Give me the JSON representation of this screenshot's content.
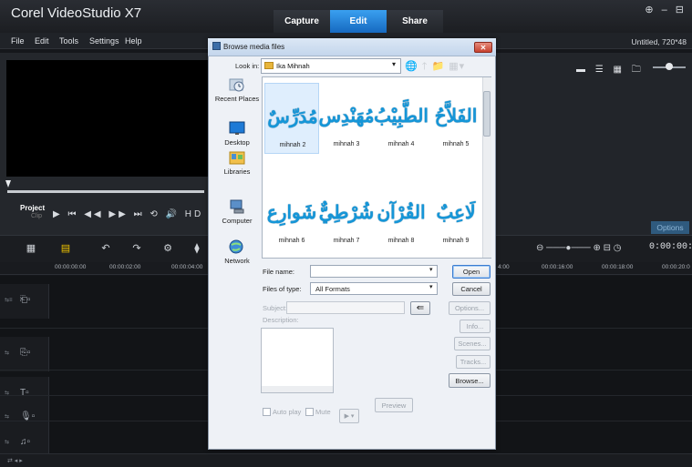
{
  "app": {
    "title": "Corel VideoStudio X7",
    "steps": [
      "Capture",
      "Edit",
      "Share"
    ],
    "window_controls": "⊕ ‒ ⊟",
    "project_info": "Untitled, 720*48"
  },
  "menu": [
    "File",
    "Edit",
    "Tools",
    "Settings",
    "Help"
  ],
  "player": {
    "project_label": "Project",
    "clip_label": "Clip",
    "controls": "▶ ⏮ ◀◀ ▶▶ ⏭ ⟲ 🔊 HD"
  },
  "right_panel": {
    "options_label": "Options",
    "view_icons": "▬ ☰ ▦ 🗀"
  },
  "timeline": {
    "ruler_ticks": [
      "00:00:00:00",
      "00:00:02:00",
      "00:00:04:00",
      "4:00",
      "00:00:16:00",
      "00:00:18:00",
      "00:00:20:0"
    ],
    "timecode": "0:00:00:00",
    "zoom_text": "⊖ ───●─── ⊕ ⊟ ◷",
    "toolbar_icons": [
      "▦",
      "▤",
      "↶",
      "↷",
      "⚙",
      "⧫"
    ]
  },
  "dialog": {
    "title": "Browse media files",
    "close_label": "✕",
    "look_in_label": "Look in:",
    "look_in_value": "Ika Mihnah",
    "nav_icons": "🌐 🡑 📁 ▦▾",
    "places": [
      "Recent Places",
      "Desktop",
      "Libraries",
      "Computer",
      "Network"
    ],
    "files": [
      {
        "name": "mihnah 2",
        "arabic": "مُدَرِّسٌ"
      },
      {
        "name": "mihnah 3",
        "arabic": "مُهَنْدِس"
      },
      {
        "name": "mihnah 4",
        "arabic": "الطَّبِيْبُ"
      },
      {
        "name": "mihnah 5",
        "arabic": "الفَلاَّحُ"
      },
      {
        "name": "mihnah 6",
        "arabic": "شَوارِع"
      },
      {
        "name": "mihnah 7",
        "arabic": "شُرْطِيٌّ"
      },
      {
        "name": "mihnah 8",
        "arabic": "القُرْآن"
      },
      {
        "name": "mihnah 9",
        "arabic": "لَاعِبٌ"
      }
    ],
    "file_name_label": "File name:",
    "file_name_value": "",
    "files_of_type_label": "Files of type:",
    "files_of_type_value": "All Formats",
    "subject_label": "Subject:",
    "description_label": "Description:",
    "buttons": {
      "open": "Open",
      "cancel": "Cancel",
      "options": "Options...",
      "info": "Info...",
      "scenes": "Scenes...",
      "tracks": "Tracks...",
      "browse": "Browse...",
      "preview": "Preview"
    },
    "auto_play_label": "Auto play",
    "mute_label": "Mute",
    "play_control": "▶ ▾"
  }
}
